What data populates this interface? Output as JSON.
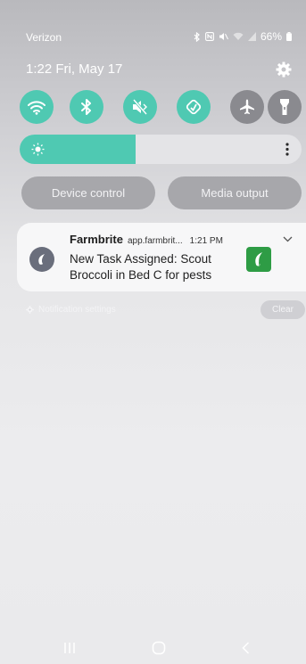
{
  "status_bar": {
    "carrier": "Verizon",
    "battery": "66%"
  },
  "header": {
    "time_date": "1:22  Fri, May 17"
  },
  "quick_settings": [
    {
      "name": "wifi",
      "state": "on"
    },
    {
      "name": "bluetooth",
      "state": "on"
    },
    {
      "name": "mute",
      "state": "on"
    },
    {
      "name": "auto-rotate",
      "state": "on"
    },
    {
      "name": "airplane-mode",
      "state": "off"
    },
    {
      "name": "flashlight",
      "state": "off"
    }
  ],
  "brightness": {
    "level_fraction": 0.41
  },
  "buttons": {
    "device_control": "Device control",
    "media_output": "Media output"
  },
  "notification": {
    "app_name": "Farmbrite",
    "source": "app.farmbrit...",
    "time": "1:21 PM",
    "message": "New Task Assigned: Scout Broccoli in Bed C for pests"
  },
  "footer": {
    "notification_settings": "Notification settings",
    "clear": "Clear"
  },
  "colors": {
    "accent": "#4fc9b2",
    "inactive": "#8a8a8f",
    "brand_green": "#2e9c45"
  }
}
